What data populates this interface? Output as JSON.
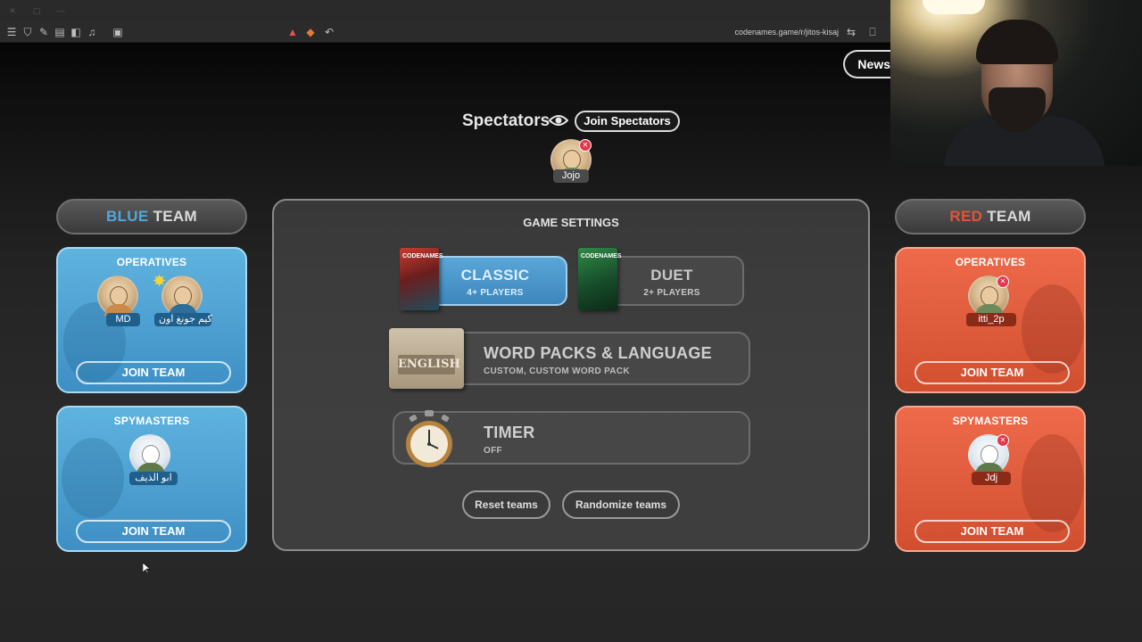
{
  "browser": {
    "url": "codenames.game/r/jitos-kisaj",
    "toolbar_icons": [
      "menu-icon",
      "shield-icon",
      "pin-icon",
      "tabs-icon",
      "sidebar-icon",
      "music-icon",
      "window-icon"
    ],
    "tab_icons": [
      "alert-icon",
      "extension-icon",
      "reload-icon"
    ]
  },
  "header": {
    "news_label": "News"
  },
  "spectators": {
    "title": "Spectators",
    "join_label": "Join Spectators",
    "players": [
      {
        "name": "Jojo"
      }
    ]
  },
  "blue_team": {
    "color_word": "BLUE",
    "team_word": "TEAM",
    "operatives": {
      "title": "OPERATIVES",
      "players": [
        {
          "name": "MD"
        },
        {
          "name": "كيم جونغ اون"
        }
      ],
      "join_label": "JOIN TEAM"
    },
    "spymasters": {
      "title": "SPYMASTERS",
      "players": [
        {
          "name": "ابو الذيف"
        }
      ],
      "join_label": "JOIN TEAM"
    }
  },
  "red_team": {
    "color_word": "RED",
    "team_word": "TEAM",
    "operatives": {
      "title": "OPERATIVES",
      "players": [
        {
          "name": "itti_2p"
        }
      ],
      "join_label": "JOIN TEAM"
    },
    "spymasters": {
      "title": "SPYMASTERS",
      "players": [
        {
          "name": "Jdj"
        }
      ],
      "join_label": "JOIN TEAM"
    }
  },
  "game_settings": {
    "title": "GAME SETTINGS",
    "modes": [
      {
        "name": "CLASSIC",
        "sub": "4+ PLAYERS",
        "box_text": "CODENAMES",
        "selected": true
      },
      {
        "name": "DUET",
        "sub": "2+ PLAYERS",
        "box_text": "CODENAMES",
        "selected": false
      }
    ],
    "word_packs": {
      "title": "WORD PACKS & LANGUAGE",
      "sub": "CUSTOM, CUSTOM WORD PACK",
      "tile_label": "ENGLISH"
    },
    "timer": {
      "title": "TIMER",
      "sub": "OFF"
    },
    "reset_label": "Reset teams",
    "randomize_label": "Randomize teams"
  },
  "colors": {
    "blue": "#4fa8dc",
    "red": "#e0553a",
    "panel": "#474747"
  }
}
